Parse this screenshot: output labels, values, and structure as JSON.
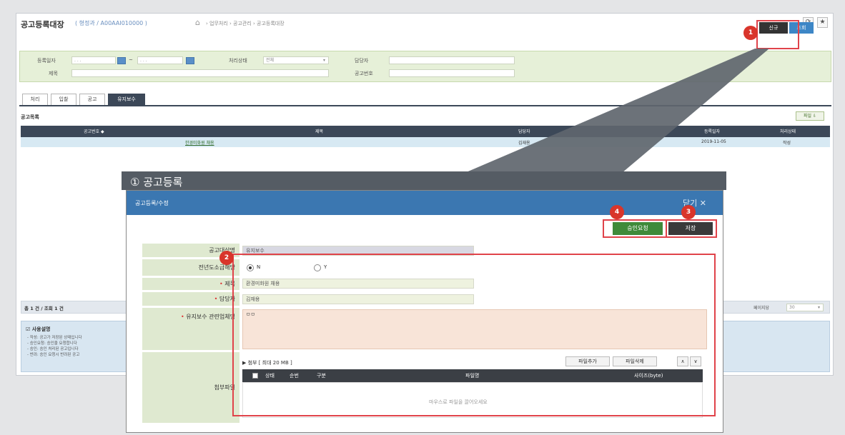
{
  "header": {
    "title": "공고등록대장",
    "user": "( 형정과 / A00AAI010000 )",
    "home_icon": "home-icon",
    "path": "› 업무처리 › 공고관리 › 공고등록대장"
  },
  "toolbar": {
    "new_label": "신규",
    "search_label": "조회"
  },
  "badges": {
    "b1": "1",
    "b2": "2",
    "b3": "3",
    "b4": "4"
  },
  "filter": {
    "reg_date_label": "등록일자",
    "reg_date_from": ". . .",
    "reg_date_to": ". . .",
    "status_label": "처리상태",
    "status_value": "전체",
    "manager_label": "담당자",
    "title_label": "제목",
    "notice_no_label": "공고번호"
  },
  "tabs": [
    "처리",
    "입찰",
    "공고",
    "유지보수"
  ],
  "list": {
    "section_title": "공고목록",
    "excel_label": "파일 ⇩",
    "columns": [
      "공고번호 ◆",
      "제목",
      "담당자",
      "등록일자",
      "처리상태"
    ],
    "rows": [
      {
        "no": "",
        "title": "한경미화원 채용",
        "manager": "김재용",
        "date": "2019-11-05",
        "status": "작성"
      }
    ]
  },
  "pager": {
    "summary": "총 1 건 / 조회 1 건",
    "per_page_label": "페이지당",
    "per_page_value": "30"
  },
  "help": {
    "title": "사용설명",
    "lines": [
      "- 작성: 공고가 저장된 상태입니다",
      "- 승인요청: 승인을 요청합니다",
      "- 승인: 승인 처리된 공고입니다",
      "- 반려: 승인 요청시 반려된 공고"
    ]
  },
  "callout": {
    "title": "① 공고등록"
  },
  "modal": {
    "title": "공고등록/수정",
    "close_label": "닫기 ✕",
    "approve_label": "승인요청",
    "save_label": "저장",
    "fields": {
      "type_label": "공고대상명",
      "type_value": "유지보수",
      "prev_label": "전년도소급해당",
      "radio_n": "N",
      "radio_y": "Y",
      "title_label": "제목",
      "title_value": "환경미화원 채용",
      "manager_label": "담당자",
      "manager_value": "김재용",
      "content_label": "유지보수 관련업체명",
      "content_value": "ㅁㅁ",
      "attach_label": "첨부파일"
    },
    "attach": {
      "title": "▶ 첨부 [ 최대 20 MB ]",
      "add_label": "파일추가",
      "del_label": "파일삭제",
      "up": "∧",
      "down": "∨",
      "columns": [
        "상태",
        "순번",
        "구분",
        "파일명",
        "사이즈(byte)"
      ],
      "empty": "마우스로 파일을 끌어오세요"
    }
  }
}
